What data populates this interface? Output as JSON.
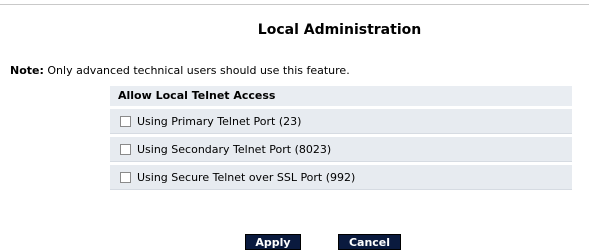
{
  "page": {
    "title": "Local Administration",
    "note_label": "Note:",
    "note_text": "Only advanced technical users should use this feature."
  },
  "panel": {
    "header": "Allow Local Telnet Access",
    "options": [
      {
        "label": "Using Primary Telnet Port (23)",
        "checked": false
      },
      {
        "label": "Using Secondary Telnet Port (8023)",
        "checked": false
      },
      {
        "label": "Using Secure Telnet over SSL Port (992)",
        "checked": false
      }
    ]
  },
  "actions": {
    "apply_label": "Apply",
    "cancel_label": "Cancel"
  }
}
